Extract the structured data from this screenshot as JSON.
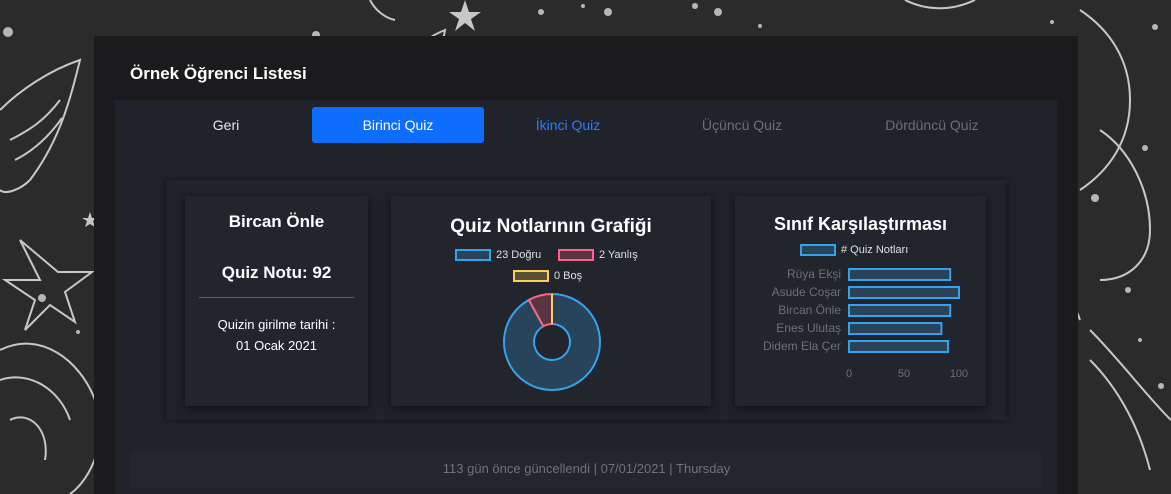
{
  "page": {
    "title": "Örnek Öğrenci Listesi"
  },
  "tabs": {
    "back": "Geri",
    "quiz1": "Birinci Quiz",
    "quiz2": "İkinci Quiz",
    "quiz3": "Üçüncü Quiz",
    "quiz4": "Dördüncü Quiz"
  },
  "student": {
    "name": "Bircan Önle",
    "grade_label": "Quiz Notu: 92",
    "date_label": "Quizin girilme tarihi :",
    "date_value": "01 Ocak 2021"
  },
  "colors": {
    "accent": "#0d6efd",
    "correct": "#36a2eb",
    "wrong": "#ff6384",
    "empty": "#ffcd56"
  },
  "chart_data": [
    {
      "type": "pie",
      "title": "Quiz Notlarının Grafiği",
      "labels": [
        "23 Doğru",
        "2 Yanlış",
        "0 Boş"
      ],
      "values": [
        23,
        2,
        0
      ],
      "legend": "top",
      "variant": "doughnut"
    },
    {
      "type": "bar",
      "orientation": "horizontal",
      "title": "Sınıf Karşılaştırması",
      "categories": [
        "Rüya Ekşi",
        "Asude Coşar",
        "Bircan Önle",
        "Enes Ulutaş",
        "Didem Ela Çer"
      ],
      "series": [
        {
          "name": "# Quiz Notları",
          "values": [
            92,
            100,
            92,
            84,
            90
          ]
        }
      ],
      "xlim": [
        0,
        100
      ],
      "xticks": [
        "0",
        "50",
        "100"
      ],
      "legend": "top",
      "grid": false
    }
  ],
  "footer": {
    "text": "113 gün önce güncellendi | 07/01/2021 | Thursday"
  }
}
